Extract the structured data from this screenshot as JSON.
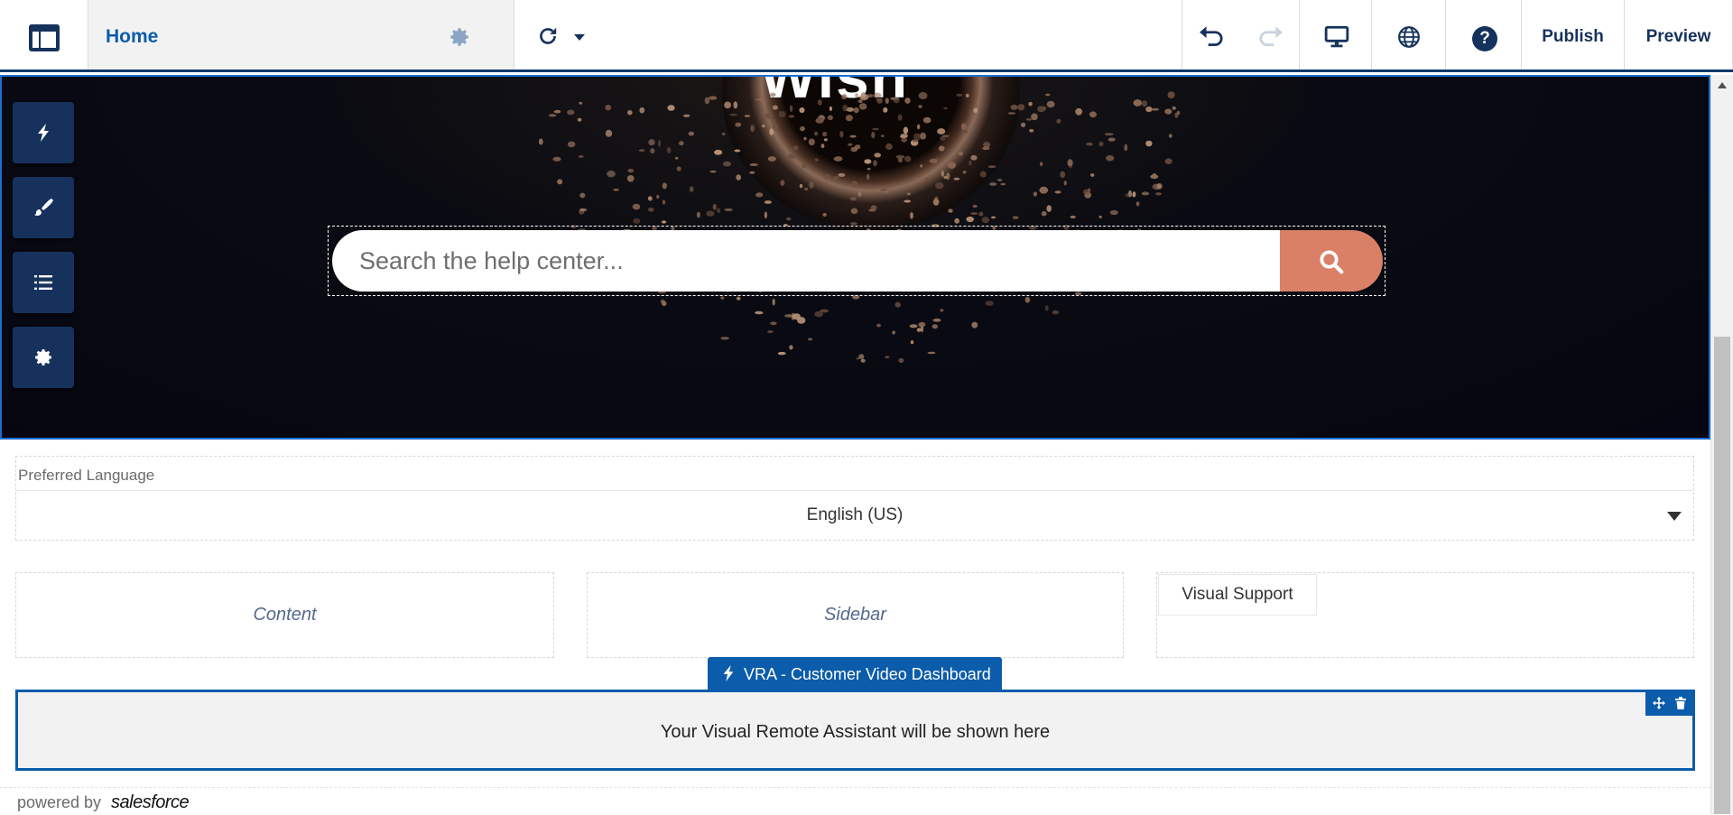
{
  "toolbar": {
    "page_name": "Home",
    "publish_label": "Publish",
    "preview_label": "Preview",
    "help_glyph": "?",
    "icons": [
      "app-logo-icon",
      "gear-icon",
      "chevron-down-icon",
      "refresh-icon",
      "undo-icon",
      "redo-icon",
      "desktop-icon",
      "globe-icon",
      "help-icon"
    ]
  },
  "hero": {
    "title_fragment": "Wish",
    "search": {
      "placeholder": "Search the help center...",
      "button_icon": "search-icon"
    },
    "colors": {
      "search_button": "#d98067",
      "selection": "#1b6fd1"
    }
  },
  "side_tools": [
    {
      "name": "components",
      "icon": "lightning-icon"
    },
    {
      "name": "theme",
      "icon": "brush-icon"
    },
    {
      "name": "pages",
      "icon": "list-icon"
    },
    {
      "name": "settings",
      "icon": "gear-icon"
    }
  ],
  "language": {
    "label": "Preferred Language",
    "selected": "English (US)"
  },
  "regions": {
    "content": "Content",
    "sidebar": "Sidebar",
    "visual_support_tab": "Visual Support"
  },
  "vra_component": {
    "title": "VRA - Customer Video Dashboard",
    "body": "Your Visual Remote Assistant will be shown here",
    "accent": "#0b5cab"
  },
  "footer": {
    "powered": "powered by",
    "brand": "salesforce"
  }
}
